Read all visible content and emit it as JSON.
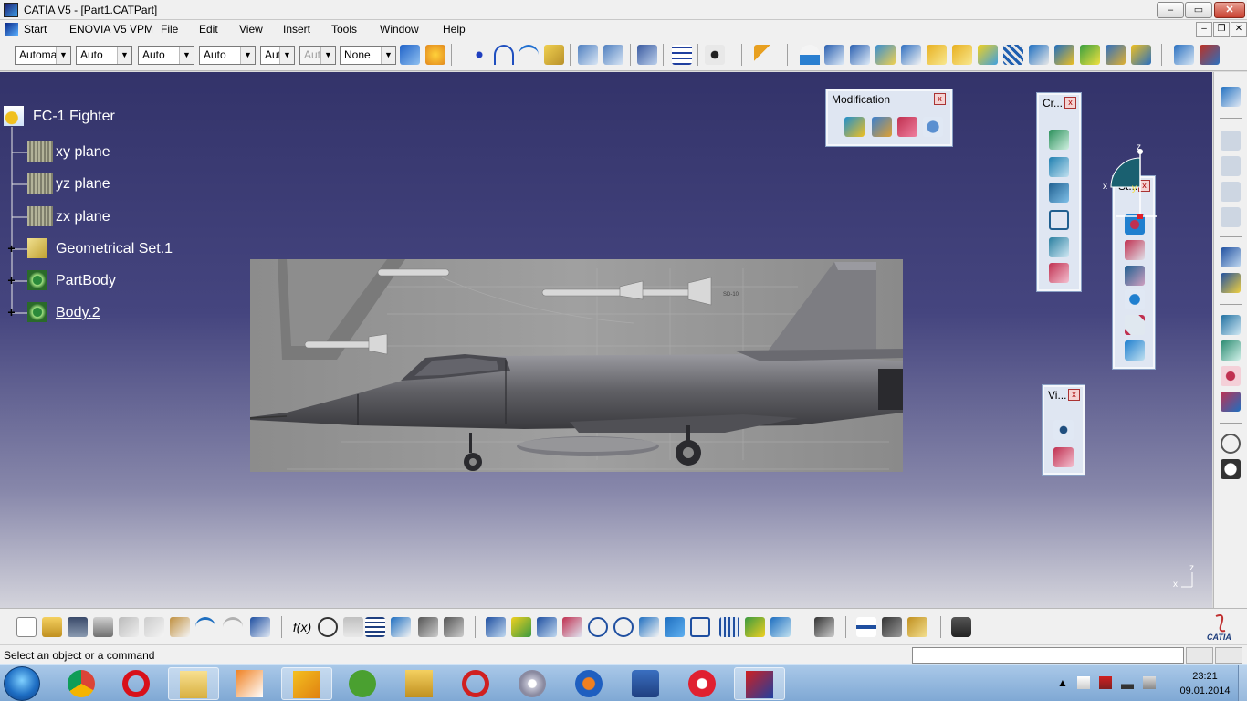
{
  "window": {
    "title": "CATIA V5 - [Part1.CATPart]",
    "minimize": "–",
    "maximize": "▭",
    "close": "✕"
  },
  "menu": {
    "items": [
      "Start",
      "ENOVIA V5 VPM",
      "File",
      "Edit",
      "View",
      "Insert",
      "Tools",
      "Window",
      "Help"
    ]
  },
  "toolbar_top": {
    "combos": [
      "Automa",
      "Auto",
      "Auto",
      "Auto",
      "Aut",
      "Aut",
      "None"
    ]
  },
  "tree": {
    "root": "FC-1 Fighter",
    "nodes": [
      "xy plane",
      "yz plane",
      "zx plane",
      "Geometrical Set.1",
      "PartBody",
      "Body.2"
    ],
    "expander": "+"
  },
  "palettes": {
    "modification": {
      "title": "Modification"
    },
    "create": {
      "title": "Cr..."
    },
    "surfaces": {
      "title": "St..."
    },
    "view": {
      "title": "Vi..."
    },
    "close_glyph": "x"
  },
  "compass": {
    "x": "x",
    "y": "y",
    "z": "z"
  },
  "axis_small": {
    "x": "x",
    "z": "z"
  },
  "status": {
    "text": "Select an object or a command"
  },
  "taskbar": {
    "time": "23:21",
    "date": "09.01.2014"
  },
  "colors": {
    "viewport_top": "#33336a",
    "viewport_bottom": "#d4d4dc",
    "tree_text": "#ffffff",
    "palette_bg": "#dfe6f2"
  }
}
